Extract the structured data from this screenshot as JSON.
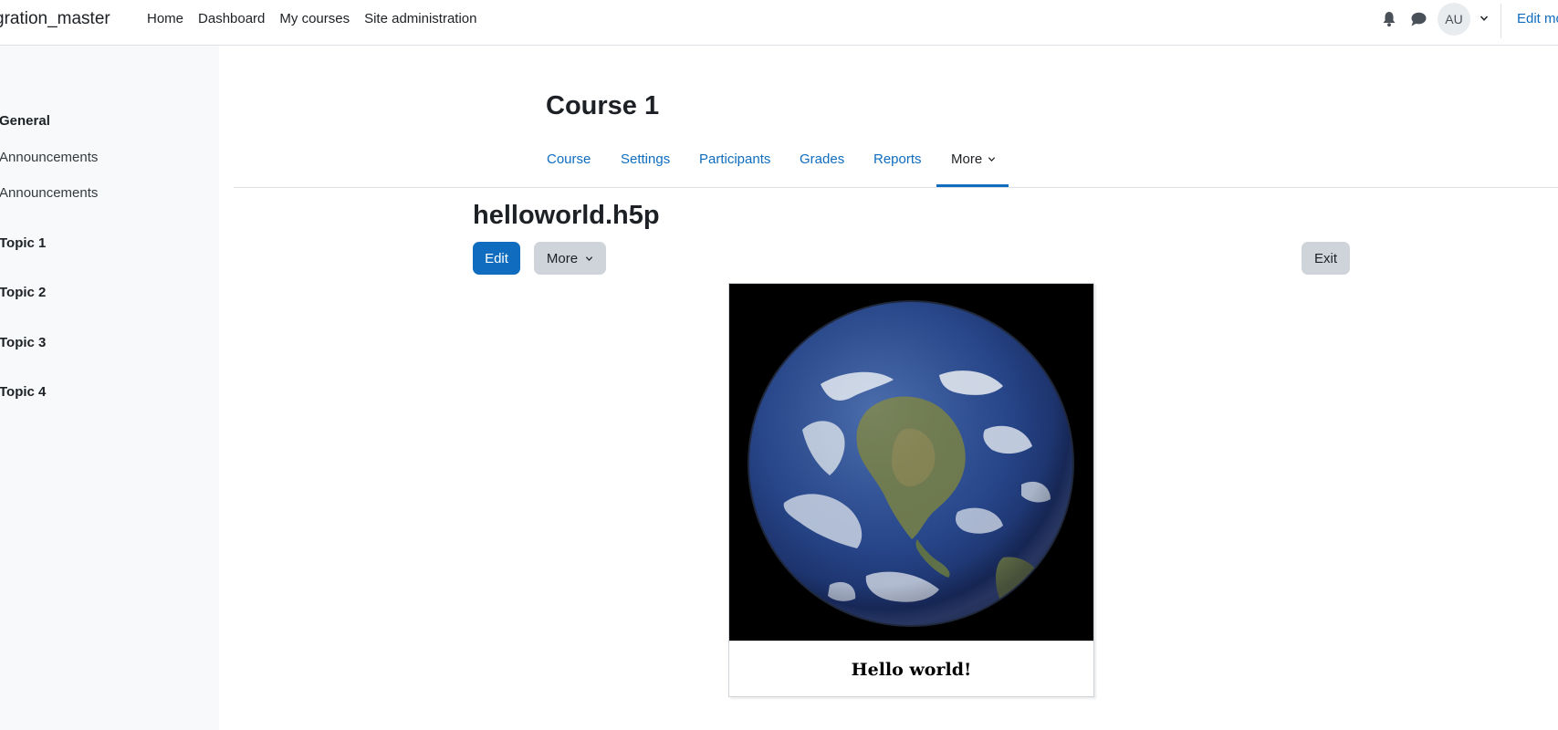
{
  "navbar": {
    "brand": "gration_master",
    "links": [
      "Home",
      "Dashboard",
      "My courses",
      "Site administration"
    ],
    "avatar_initials": "AU",
    "edit_mode_label": "Edit mo"
  },
  "drawer": {
    "general": "General",
    "items": [
      "Announcements",
      "Announcements"
    ],
    "topics": [
      "Topic 1",
      "Topic 2",
      "Topic 3",
      "Topic 4"
    ]
  },
  "course": {
    "title": "Course 1",
    "tabs": [
      "Course",
      "Settings",
      "Participants",
      "Grades",
      "Reports",
      "More"
    ],
    "active_tab": "More"
  },
  "activity": {
    "title": "helloworld.h5p",
    "edit_label": "Edit",
    "more_label": "More",
    "exit_label": "Exit"
  },
  "h5p": {
    "caption": "Hello world!",
    "image": "earth-globe"
  },
  "colors": {
    "accent": "#0f6cbf",
    "drawer_bg": "#f8f9fa",
    "button_secondary": "#ced4da"
  }
}
